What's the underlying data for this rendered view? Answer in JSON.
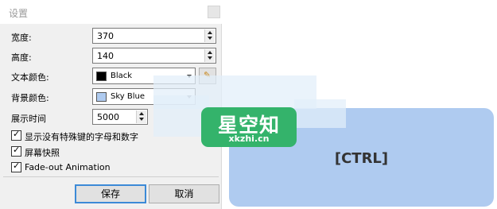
{
  "dialog": {
    "title": "设置",
    "width_label": "宽度:",
    "width_value": "370",
    "height_label": "高度:",
    "height_value": "140",
    "text_color_label": "文本颜色:",
    "text_color_name": "Black",
    "text_color_hex": "#000000",
    "bg_color_label": "背景颜色:",
    "bg_color_name": "Sky Blue",
    "bg_color_hex": "#afcbf0",
    "display_time_label": "展示时间",
    "display_time_value": "5000",
    "checkboxes": [
      {
        "label": "显示没有特殊键的字母和数字",
        "checked": true
      },
      {
        "label": "屏幕快照",
        "checked": true
      },
      {
        "label": "Fade-out Animation",
        "checked": true
      }
    ],
    "check_mark": "✓",
    "save_label": "保存",
    "cancel_label": "取消"
  },
  "key_display": {
    "text": "[CTRL]",
    "background": "#afcbf0"
  },
  "watermark": {
    "brand": "星空知",
    "domain": "xkzhi.cn",
    "color": "#34b36b"
  }
}
